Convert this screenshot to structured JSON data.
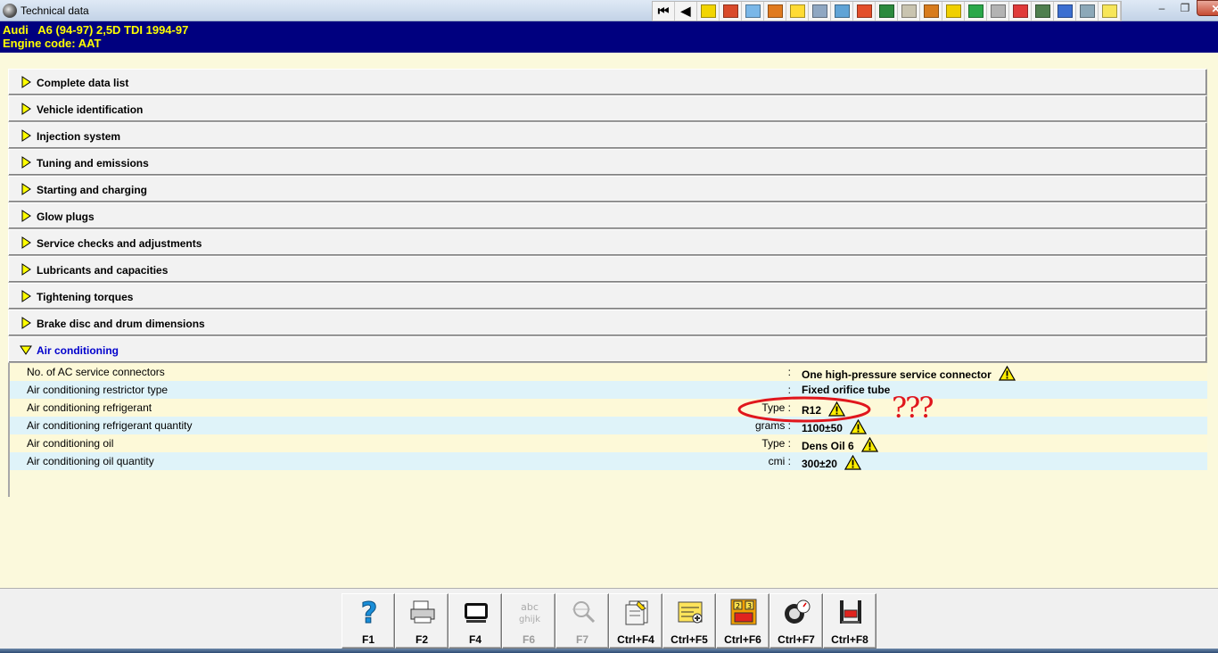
{
  "window": {
    "title": "Technical data",
    "minimize": "–",
    "restore": "❐",
    "close": "✕"
  },
  "toolbar": {
    "first_label": "⏮",
    "prev_label": "◀",
    "icons": [
      {
        "name": "warning-icon",
        "color": "#f2d500"
      },
      {
        "name": "doc-icon",
        "color": "#d94a2b"
      },
      {
        "name": "plane-icon",
        "color": "#7ab7e8"
      },
      {
        "name": "engine-icon",
        "color": "#e07a1f"
      },
      {
        "name": "ignition-icon",
        "color": "#ffdb34"
      },
      {
        "name": "gauge-icon",
        "color": "#8fa7c2"
      },
      {
        "name": "wrench-icon",
        "color": "#5fa3d6"
      },
      {
        "name": "belt-icon",
        "color": "#e34e2a"
      },
      {
        "name": "fuse-icon",
        "color": "#2b8a3e"
      },
      {
        "name": "lubrication-icon",
        "color": "#c9c4b0"
      },
      {
        "name": "bottle-icon",
        "color": "#d87c1e"
      },
      {
        "name": "numbers-icon",
        "color": "#f0d000"
      },
      {
        "name": "ac-icon",
        "color": "#2aa84a"
      },
      {
        "name": "torque-icon",
        "color": "#b3b3b3"
      },
      {
        "name": "car-icon",
        "color": "#e03a3a"
      },
      {
        "name": "clock-icon",
        "color": "#4f7f4f"
      },
      {
        "name": "triangle-icon",
        "color": "#3c6fd1"
      },
      {
        "name": "van-icon",
        "color": "#8ca8b8"
      },
      {
        "name": "exit-icon",
        "color": "#f7e65a"
      }
    ]
  },
  "header": {
    "line1": "Audi   A6 (94-97) 2,5D TDI 1994-97",
    "line2": "Engine code: AAT"
  },
  "sections": [
    "Complete data list",
    "Vehicle identification",
    "Injection system",
    "Tuning and emissions",
    "Starting and charging",
    "Glow plugs",
    "Service checks and adjustments",
    "Lubricants and capacities",
    "Tightening torques",
    "Brake disc and drum dimensions"
  ],
  "ac": {
    "title": "Air conditioning",
    "rows": [
      {
        "name": "No. of AC service connectors",
        "unit": ":",
        "value": "One high-pressure service connector",
        "warning": true
      },
      {
        "name": "Air conditioning restrictor type",
        "unit": ":",
        "value": "Fixed orifice tube",
        "warning": false
      },
      {
        "name": "Air conditioning refrigerant",
        "unit": "Type :",
        "value": "R12",
        "warning": true
      },
      {
        "name": "Air conditioning refrigerant quantity",
        "unit": "grams :",
        "value": "1100±50",
        "warning": true
      },
      {
        "name": "Air conditioning oil",
        "unit": "Type :",
        "value": "Dens Oil 6",
        "warning": true
      },
      {
        "name": "Air conditioning oil quantity",
        "unit": "cmi :",
        "value": "300±20",
        "warning": true
      }
    ],
    "annotation": "???"
  },
  "fkeys": [
    {
      "label": "F1",
      "icon": "help-icon",
      "disabled": false
    },
    {
      "label": "F2",
      "icon": "printer-icon",
      "disabled": false
    },
    {
      "label": "F4",
      "icon": "screen-icon",
      "disabled": false
    },
    {
      "label": "F6",
      "icon": "abc-icon",
      "disabled": true
    },
    {
      "label": "F7",
      "icon": "magnifier-icon",
      "disabled": true
    },
    {
      "label": "Ctrl+F4",
      "icon": "note-icon",
      "disabled": false
    },
    {
      "label": "Ctrl+F5",
      "icon": "list-add-icon",
      "disabled": false
    },
    {
      "label": "Ctrl+F6",
      "icon": "numbers-icon",
      "disabled": false
    },
    {
      "label": "Ctrl+F7",
      "icon": "gauge-icon",
      "disabled": false
    },
    {
      "label": "Ctrl+F8",
      "icon": "lift-icon",
      "disabled": false
    }
  ]
}
